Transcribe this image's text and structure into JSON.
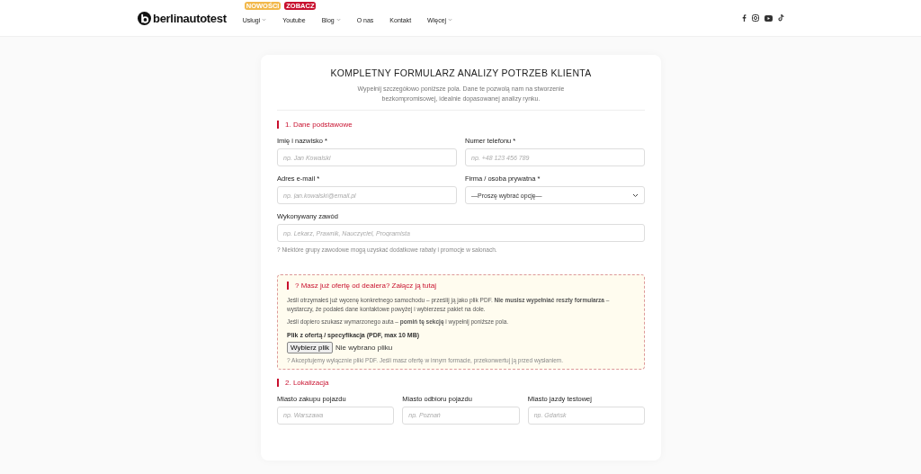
{
  "header": {
    "logo": "berlinautotest",
    "nav": [
      {
        "label": "Usługi",
        "badge": "NOWOŚCI",
        "color": "#f2b84b",
        "dropdown": true
      },
      {
        "label": "Youtube",
        "badge": "ZOBACZ",
        "color": "#c8102e",
        "dropdown": false
      },
      {
        "label": "Blog",
        "dropdown": true
      },
      {
        "label": "O nas",
        "dropdown": false
      },
      {
        "label": "Kontakt",
        "dropdown": false
      },
      {
        "label": "Więcej",
        "dropdown": true
      }
    ],
    "social": [
      {
        "kind": "facebook"
      },
      {
        "kind": "instagram"
      },
      {
        "kind": "youtube"
      },
      {
        "kind": "tiktok"
      }
    ]
  },
  "form": {
    "title": "KOMPLETNY FORMULARZ ANALIZY POTRZEB KLIENTA",
    "subtitle": "Wypełnij szczegółowo poniższe pola. Dane te pozwolą nam na stworzenie bezkompromisowej, idealnie dopasowanej analizy rynku.",
    "section_1": {
      "title": "1. Dane podstawowe",
      "fields": [
        {
          "kind": "input",
          "label": "Imię i nazwisko *",
          "placeholder": "np. Jan Kowalski"
        },
        {
          "kind": "input",
          "label": "Numer telefonu *",
          "placeholder": "np. +48 123 456 789"
        },
        {
          "kind": "input",
          "label": "Adres e-mail *",
          "placeholder": "np. jan.kowalski@email.pl"
        },
        {
          "kind": "select",
          "label": "Firma / osoba prywatna *",
          "value": "—Proszę wybrać opcję—"
        },
        {
          "kind": "wide_input",
          "label": "Wykonywany zawód",
          "placeholder": "np. Lekarz, Prawnik, Nauczyciel, Programista",
          "hint": "? Niektóre grupy zawodowe mogą uzyskać dodatkowe rabaty i promocje w salonach."
        }
      ]
    },
    "dealer_box": {
      "title": "? Masz już ofertę od dealera? Załącz ją tutaj",
      "paragraphs": [
        "Jeśli otrzymałeś już wycenę konkretnego samochodu – prześlij ją jako plik PDF. **Nie musisz wypełniać reszty formularza** – wystarczy, że podałeś dane kontaktowe powyżej i wybierzesz pakiet na dole.",
        "Jeśli dopiero szukasz wymarzonego auta – **pomiń tę sekcję** i wypełnij poniższe pola."
      ],
      "file_label": "Plik z ofertą / specyfikacja (PDF, max 10 MB)",
      "file_button": "Wybierz plik",
      "file_status": "Nie wybrano pliku",
      "hint": "? Akceptujemy wyłącznie pliki PDF. Jeśli masz ofertę w innym formacie, przekonwertuj ją przed wysłaniem."
    },
    "section_2": {
      "title": "2. Lokalizacja",
      "fields": [
        {
          "kind": "input",
          "label": "Miasto zakupu pojazdu",
          "placeholder": "np. Warszawa"
        },
        {
          "kind": "input",
          "label": "Miasto odbioru pojazdu",
          "placeholder": "np. Poznań"
        },
        {
          "kind": "input",
          "label": "Miasto jazdy testowej",
          "placeholder": "np. Gdańsk"
        }
      ]
    }
  }
}
